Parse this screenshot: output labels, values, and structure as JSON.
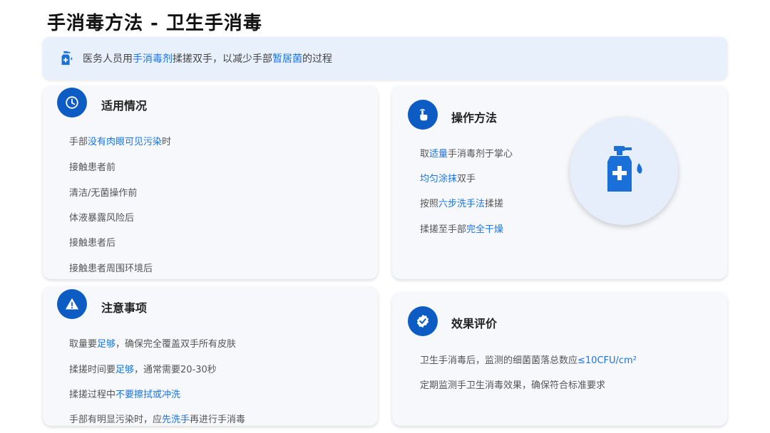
{
  "page": {
    "title": "手消毒方法 - 卫生手消毒"
  },
  "banner": {
    "icon": "sanitizer-bottle-icon",
    "segments": [
      "医务人员用",
      "手消毒剂",
      "揉搓双手，以减少手部",
      "暂居菌",
      "的过程"
    ]
  },
  "usage": {
    "icon": "clock-icon",
    "title": "适用情况",
    "items": [
      {
        "parts": [
          "手部",
          "没有肉眼可见污染",
          "时"
        ]
      },
      {
        "parts": [
          "接触患者前"
        ]
      },
      {
        "parts": [
          "清洁/无菌操作前"
        ]
      },
      {
        "parts": [
          "体液暴露风险后"
        ]
      },
      {
        "parts": [
          "接触患者后"
        ]
      },
      {
        "parts": [
          "接触患者周围环境后"
        ]
      }
    ]
  },
  "method": {
    "icon": "hand-touch-icon",
    "title": "操作方法",
    "illustration_icon": "sanitizer-bottle-icon",
    "items": [
      {
        "parts": [
          "取",
          "适量",
          "手消毒剂于掌心"
        ]
      },
      {
        "parts": [
          "",
          "均匀涂抹",
          "双手"
        ]
      },
      {
        "parts": [
          "按照",
          "六步洗手法",
          "揉搓"
        ]
      },
      {
        "parts": [
          "揉搓至手部",
          "完全干燥",
          ""
        ]
      }
    ]
  },
  "notes": {
    "icon": "warning-icon",
    "title": "注意事项",
    "items": [
      {
        "parts": [
          "取量要",
          "足够",
          "，确保完全覆盖双手所有皮肤"
        ]
      },
      {
        "parts": [
          "揉搓时间要",
          "足够",
          "，通常需要20-30秒"
        ]
      },
      {
        "parts": [
          "揉搓过程中",
          "不要擦拭或冲洗",
          ""
        ]
      },
      {
        "parts": [
          "手部有明显污染时，应",
          "先洗手",
          "再进行手消毒"
        ]
      }
    ]
  },
  "evaluation": {
    "icon": "verified-check-icon",
    "title": "效果评价",
    "items": [
      {
        "parts": [
          "卫生手消毒后，监测的细菌菌落总数应",
          "≤10CFU/cm²",
          ""
        ]
      },
      {
        "parts": [
          "定期监测手卫生消毒效果，确保符合标准要求"
        ]
      }
    ]
  },
  "colors": {
    "accent": "#1a73e8",
    "icon_bg": "#0d5cc4",
    "banner_bg": "#e8f0fc",
    "card_bg": "#f6f8fb"
  }
}
